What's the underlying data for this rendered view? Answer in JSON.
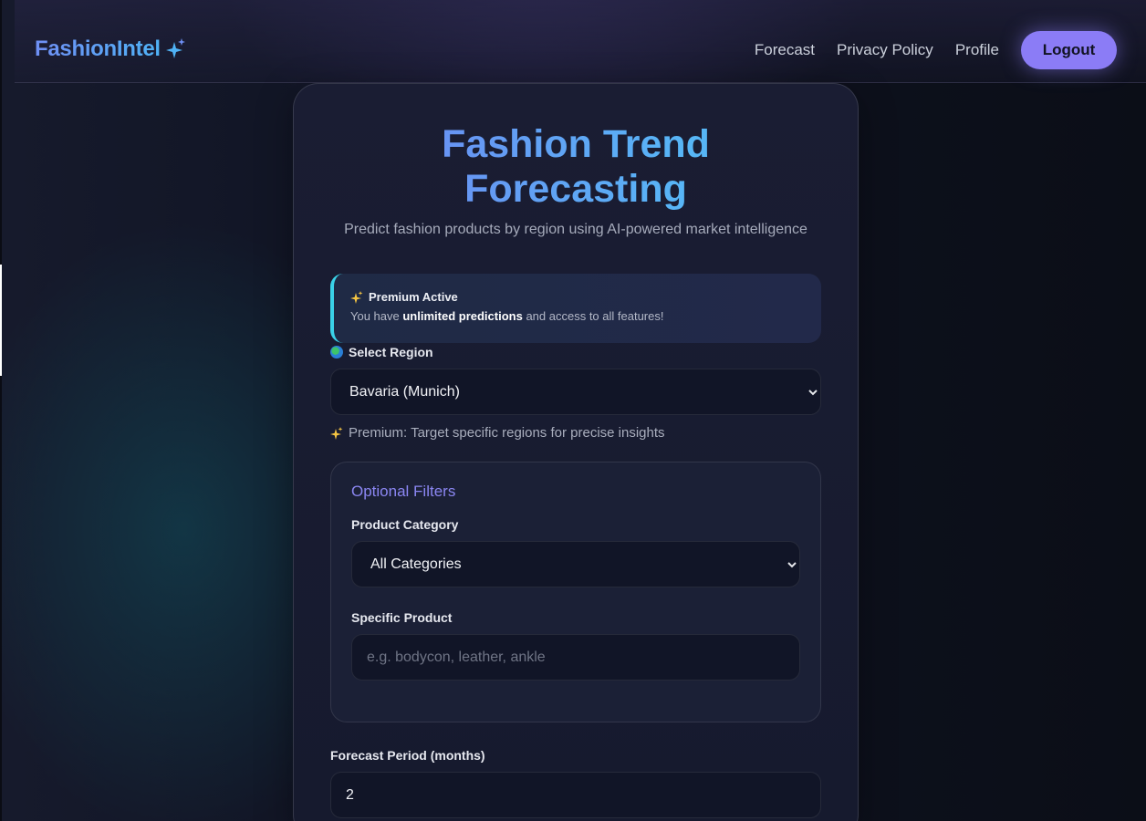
{
  "nav": {
    "brand": "FashionIntel",
    "links": [
      "Forecast",
      "Privacy Policy",
      "Profile"
    ],
    "logout_label": "Logout"
  },
  "card": {
    "title_line1": "Fashion Trend",
    "title_line2": "Forecasting",
    "subtitle": "Predict fashion products by region using AI-powered market intelligence"
  },
  "premium": {
    "icon": "sparkles-icon",
    "title": "Premium Active",
    "text_before": "You have ",
    "text_strong": "unlimited predictions",
    "text_after": " and access to all features!"
  },
  "region": {
    "label": "Select Region",
    "icon": "globe-icon",
    "selected": "Bavaria (Munich)",
    "helper": "Premium: Target specific regions for precise insights"
  },
  "filters": {
    "title": "Optional Filters",
    "category_label": "Product Category",
    "category_selected": "All Categories",
    "product_label": "Specific Product",
    "product_placeholder": "e.g. bodycon, leather, ankle",
    "product_value": ""
  },
  "forecast": {
    "label": "Forecast Period (months)",
    "value": "2"
  },
  "colors": {
    "accent": "#8b7cf6",
    "brand_gradient_start": "#6f8ff5",
    "brand_gradient_end": "#4fb2f5",
    "premium_border": "#3ad2e8",
    "filters_title": "#8b86f2"
  }
}
